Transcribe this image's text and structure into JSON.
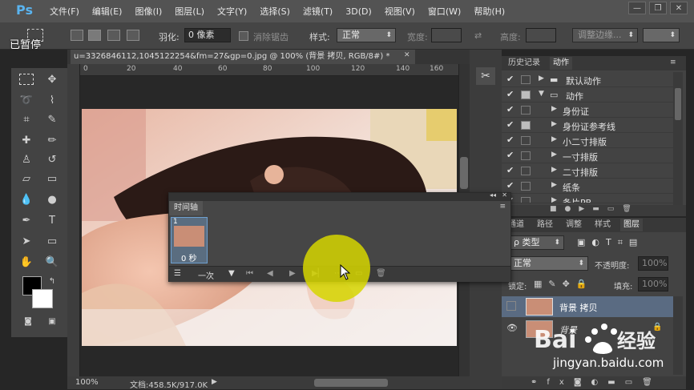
{
  "menubar": {
    "logo": "Ps",
    "items": [
      "文件(F)",
      "编辑(E)",
      "图像(I)",
      "图层(L)",
      "文字(Y)",
      "选择(S)",
      "滤镜(T)",
      "3D(D)",
      "视图(V)",
      "窗口(W)",
      "帮助(H)"
    ],
    "controls": [
      "—",
      "❐",
      "✕"
    ]
  },
  "overlay": {
    "paused": "已暂停"
  },
  "options": {
    "feather_label": "羽化:",
    "feather_value": "0 像素",
    "antialias_label": "消除锯齿",
    "style_label": "样式:",
    "style_value": "正常",
    "width_label": "宽度:",
    "height_label": "高度:",
    "refine_button": "调整边缘..."
  },
  "document": {
    "tab_title": "u=3326846112,1045122254&fm=27&gp=0.jpg @ 100% (背景 拷贝, RGB/8#) *",
    "ruler_ticks": [
      "0",
      "20",
      "40",
      "60",
      "80",
      "100",
      "120",
      "140",
      "160"
    ]
  },
  "status": {
    "zoom": "100%",
    "doc_info": "文档:458.5K/917.0K"
  },
  "actions_panel": {
    "tabs": [
      "历史记录",
      "动作"
    ],
    "rows": [
      {
        "label": "默认动作",
        "type": "folder",
        "indent": 0
      },
      {
        "label": "动作",
        "type": "folder-open",
        "indent": 0
      },
      {
        "label": "身份证",
        "type": "action",
        "indent": 1
      },
      {
        "label": "身份证参考线",
        "type": "action",
        "indent": 1
      },
      {
        "label": "小二寸排版",
        "type": "action",
        "indent": 1
      },
      {
        "label": "一寸排版",
        "type": "action",
        "indent": 1
      },
      {
        "label": "二寸排版",
        "type": "action",
        "indent": 1
      },
      {
        "label": "纸条",
        "type": "action",
        "indent": 1
      },
      {
        "label": "条片PB",
        "type": "action",
        "indent": 1
      }
    ]
  },
  "layers_panel": {
    "tabs": [
      "通道",
      "路径",
      "调整",
      "样式",
      "图层"
    ],
    "filter_label": "ρ 类型",
    "blend_mode": "正常",
    "opacity_label": "不透明度:",
    "opacity_value": "100%",
    "lock_label": "锁定:",
    "fill_label": "填充:",
    "fill_value": "100%",
    "layers": [
      {
        "name": "背景 拷贝",
        "selected": true
      },
      {
        "name": "背景",
        "selected": false
      }
    ]
  },
  "timeline": {
    "tab": "时间轴",
    "frame_number": "1",
    "frame_delay": "0 秒",
    "loop_value": "一次"
  },
  "watermark": {
    "logo": "Baidu经验",
    "url": "jingyan.baidu.com"
  }
}
